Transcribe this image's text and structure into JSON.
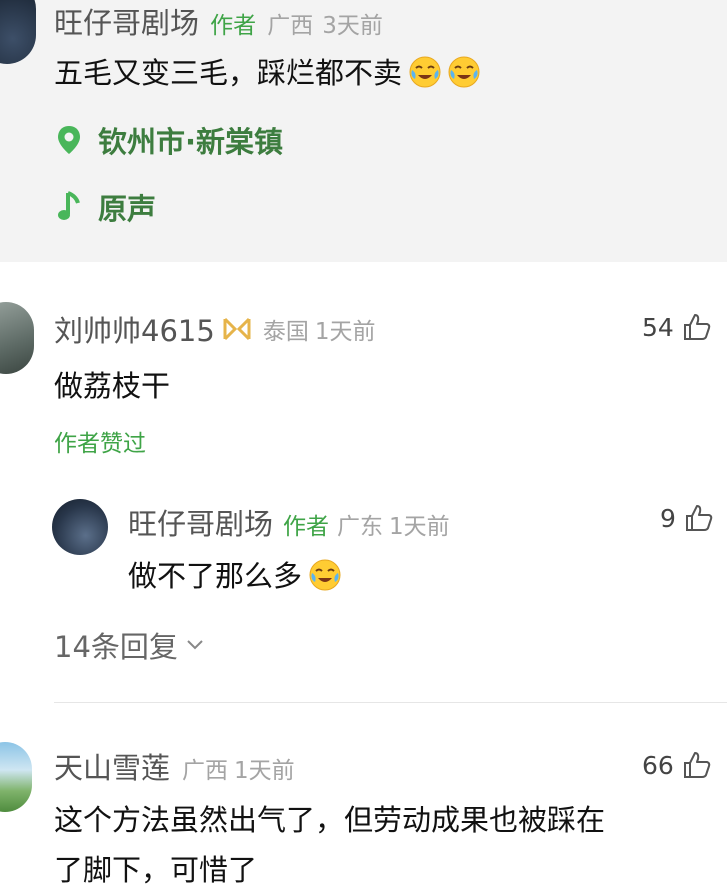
{
  "post": {
    "author_name": "旺仔哥剧场",
    "author_tag": "作者",
    "region": "广西",
    "time": "3天前",
    "text": "五毛又变三毛，踩烂都不卖",
    "emoji_icons": [
      "cry-laugh-emoji",
      "cry-laugh-emoji"
    ],
    "location": "钦州市·新棠镇",
    "sound": "原声",
    "colors": {
      "accent_green": "#3fa447",
      "card_bg": "#f3f3f3"
    }
  },
  "comments": [
    {
      "user": "刘帅帅4615",
      "badge_icon": "ribbon-badge-icon",
      "region": "泰国",
      "time": "1天前",
      "likes": "54",
      "text": "做荔枝干",
      "liked_by_author": "作者赞过",
      "reply": {
        "user": "旺仔哥剧场",
        "author_tag": "作者",
        "region": "广东",
        "time": "1天前",
        "likes": "9",
        "text": "做不了那么多",
        "emoji_icon": "cry-laugh-emoji"
      },
      "more_replies": "14条回复"
    },
    {
      "user": "天山雪莲",
      "region": "广西",
      "time": "1天前",
      "likes": "66",
      "text_line1": "这个方法虽然出气了，但劳动成果也被踩在",
      "text_line2": "了脚下，可惜了"
    }
  ]
}
